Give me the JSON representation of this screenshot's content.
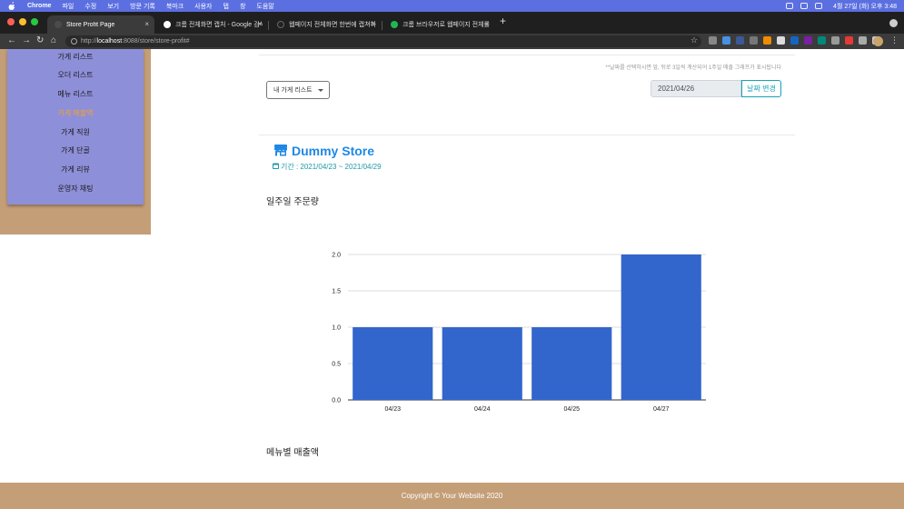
{
  "mac_menubar": {
    "app": "Chrome",
    "items": [
      "파일",
      "수정",
      "보기",
      "방문 기록",
      "북마크",
      "사용자",
      "탭",
      "창",
      "도움말"
    ],
    "clock": "4월 27일 (화) 오후 3:48"
  },
  "browser": {
    "tabs": [
      {
        "title": "Store Profit Page",
        "favicon_color": "#4b4b4b"
      },
      {
        "title": "크롬 전체화면 캡처 - Google 검색",
        "favicon_color": "#ffffff"
      },
      {
        "title": "웹페이지 전체화면 한번에 캡쳐하기(크",
        "favicon_color": "#222222"
      },
      {
        "title": "크롬 브라우저로 웹페이지 전체를 한 번",
        "favicon_color": "#1db954"
      }
    ],
    "address": {
      "scheme": "http://",
      "host": "localhost",
      "path": ":8088/store/store-profit#"
    }
  },
  "sidebar": {
    "items": [
      {
        "label": "가게 리스트",
        "active": false
      },
      {
        "label": "오더 리스트",
        "active": false
      },
      {
        "label": "메뉴 리스트",
        "active": false
      },
      {
        "label": "가게 매출액",
        "active": true
      },
      {
        "label": "가게 직원",
        "active": false
      },
      {
        "label": "가게 단골",
        "active": false
      },
      {
        "label": "가게 리뷰",
        "active": false
      },
      {
        "label": "운영자 채팅",
        "active": false
      }
    ]
  },
  "filters": {
    "hint": "**날짜를 선택하시면 앞, 뒤로 3일씩 계산되어 1주일 매출 그래프가 표시됩니다",
    "store_select": "내 가게 리스트",
    "date_value": "2021/04/26",
    "date_button": "날짜 변경"
  },
  "store": {
    "name": "Dummy Store",
    "period": "기간 : 2021/04/23 ~ 2021/04/29"
  },
  "sections": {
    "weekly_orders": "일주일 주문량",
    "menu_sales": "메뉴별 매출액"
  },
  "chart_data": {
    "type": "bar",
    "categories": [
      "04/23",
      "04/24",
      "04/25",
      "04/27"
    ],
    "values": [
      1,
      1,
      1,
      2
    ],
    "ylim": [
      0,
      2
    ],
    "yticks": [
      "0.0",
      "0.5",
      "1.0",
      "1.5",
      "2.0"
    ],
    "color": "#3366cc",
    "grid": true
  },
  "footer": {
    "text": "Copyright © Your Website 2020"
  }
}
